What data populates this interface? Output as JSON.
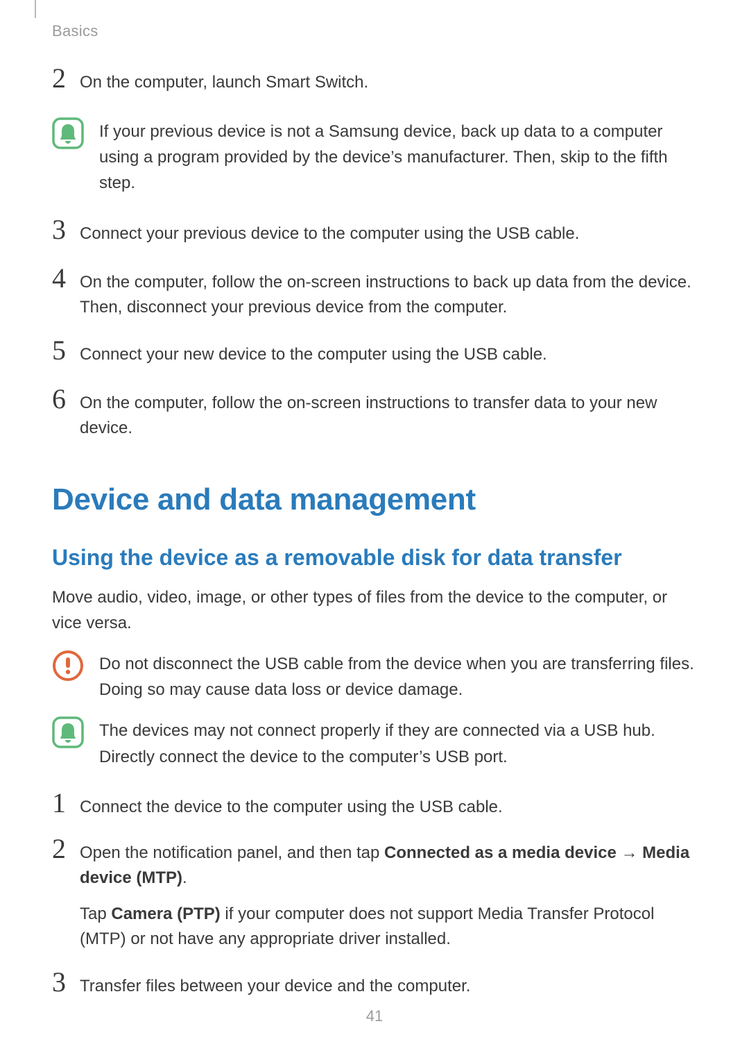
{
  "header": {
    "section": "Basics"
  },
  "steps_a": [
    {
      "n": "2",
      "text": "On the computer, launch Smart Switch."
    },
    {
      "n": "3",
      "text": "Connect your previous device to the computer using the USB cable."
    },
    {
      "n": "4",
      "text": "On the computer, follow the on-screen instructions to back up data from the device. Then, disconnect your previous device from the computer."
    },
    {
      "n": "5",
      "text": "Connect your new device to the computer using the USB cable."
    },
    {
      "n": "6",
      "text": "On the computer, follow the on-screen instructions to transfer data to your new device."
    }
  ],
  "note_a": "If your previous device is not a Samsung device, back up data to a computer using a program provided by the device’s manufacturer. Then, skip to the fifth step.",
  "h1": "Device and data management",
  "h2": "Using the device as a removable disk for data transfer",
  "intro": "Move audio, video, image, or other types of files from the device to the computer, or vice versa.",
  "warn": "Do not disconnect the USB cable from the device when you are transferring files. Doing so may cause data loss or device damage.",
  "note_b": "The devices may not connect properly if they are connected via a USB hub. Directly connect the device to the computer’s USB port.",
  "steps_b": {
    "s1": {
      "n": "1",
      "text": "Connect the device to the computer using the USB cable."
    },
    "s2": {
      "n": "2",
      "pre": "Open the notification panel, and then tap ",
      "bold1": "Connected as a media device",
      "arrow": " → ",
      "bold2": "Media device (MTP)",
      "post": ".",
      "sub_pre": "Tap ",
      "sub_bold": "Camera (PTP)",
      "sub_post": " if your computer does not support Media Transfer Protocol (MTP) or not have any appropriate driver installed."
    },
    "s3": {
      "n": "3",
      "text": "Transfer files between your device and the computer."
    }
  },
  "page_number": "41"
}
